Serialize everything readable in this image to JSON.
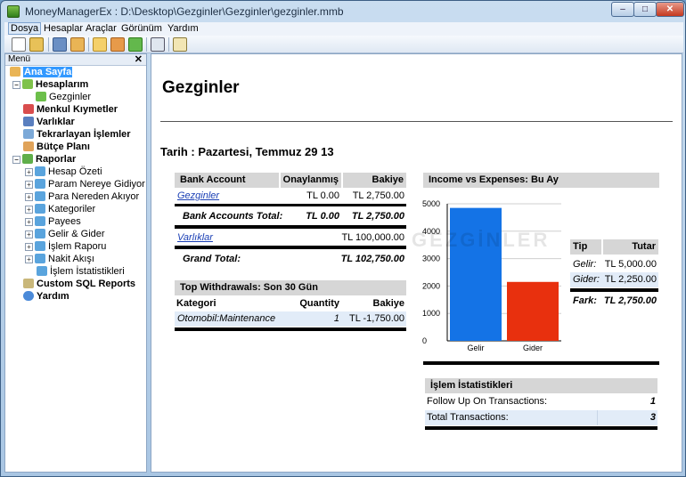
{
  "window": {
    "title": "MoneyManagerEx : D:\\Desktop\\Gezginler\\Gezginler\\gezginler.mmb",
    "min": "–",
    "max": "□",
    "close": "✕"
  },
  "menubar": {
    "items": [
      "Dosya",
      "Hesaplar",
      "Araçlar",
      "Görünüm",
      "Yardım"
    ]
  },
  "sidebar": {
    "header": "Menü",
    "close": "✕",
    "items": [
      {
        "label": "Ana Sayfa",
        "icon": "home-icon"
      },
      {
        "label": "Hesaplarım",
        "icon": "accounts-icon"
      },
      {
        "label": "Gezginler",
        "icon": "account-icon"
      },
      {
        "label": "Menkul Kıymetler",
        "icon": "stocks-icon"
      },
      {
        "label": "Varlıklar",
        "icon": "car-icon"
      },
      {
        "label": "Tekrarlayan İşlemler",
        "icon": "repeat-icon"
      },
      {
        "label": "Bütçe Planı",
        "icon": "budget-icon"
      },
      {
        "label": "Raporlar",
        "icon": "reports-icon"
      },
      {
        "label": "Hesap Özeti",
        "icon": "pie-icon"
      },
      {
        "label": "Param Nereye Gidiyor",
        "icon": "pie-icon"
      },
      {
        "label": "Para Nereden Akıyor",
        "icon": "pie-icon"
      },
      {
        "label": "Kategoriler",
        "icon": "pie-icon"
      },
      {
        "label": "Payees",
        "icon": "pie-icon"
      },
      {
        "label": "Gelir & Gider",
        "icon": "pie-icon"
      },
      {
        "label": "İşlem Raporu",
        "icon": "pie-icon"
      },
      {
        "label": "Nakit Akışı",
        "icon": "pie-icon"
      },
      {
        "label": "İşlem İstatistikleri",
        "icon": "pie-icon"
      },
      {
        "label": "Custom SQL Reports",
        "icon": "sql-icon"
      },
      {
        "label": "Yardım",
        "icon": "help-icon"
      }
    ]
  },
  "main": {
    "title": "Gezginler",
    "date": "Tarih : Pazartesi, Temmuz 29 13",
    "accounts": {
      "headers": [
        "Bank Account",
        "Onaylanmış",
        "Bakiye"
      ],
      "rows": [
        {
          "name": "Gezginler",
          "reconciled": "TL  0.00",
          "balance": "TL  2,750.00"
        }
      ],
      "total_label": "Bank Accounts Total:",
      "total_reconciled": "TL  0.00",
      "total_balance": "TL  2,750.00",
      "asset_row": {
        "name": "Varlıklar",
        "balance": "TL  100,000.00"
      },
      "grand_label": "Grand Total:",
      "grand_total": "TL  102,750.00"
    },
    "withdrawals": {
      "title": "Top Withdrawals: Son 30 Gün",
      "headers": [
        "Kategori",
        "Quantity",
        "Bakiye"
      ],
      "rows": [
        {
          "category": "Otomobil:Maintenance",
          "qty": "1",
          "amount": "TL  -1,750.00"
        }
      ]
    },
    "income_expenses": {
      "title": "Income vs Expenses: Bu Ay",
      "table_headers": [
        "Tip",
        "Tutar"
      ],
      "rows": [
        {
          "type": "Gelir:",
          "amount": "TL  5,000.00"
        },
        {
          "type": "Gider:",
          "amount": "TL  2,250.00"
        }
      ],
      "diff_label": "Fark:",
      "diff_value": "TL  2,750.00"
    },
    "stats": {
      "title": "İşlem İstatistikleri",
      "rows": [
        {
          "label": "Follow Up On Transactions:",
          "value": "1"
        },
        {
          "label": "Total Transactions:",
          "value": "3"
        }
      ]
    },
    "watermark": "GEZGİNLER"
  },
  "chart_data": {
    "type": "bar",
    "categories": [
      "Gelir",
      "Gider"
    ],
    "values": [
      4850,
      2150
    ],
    "colors": [
      "#1473e6",
      "#e8300e"
    ],
    "ylim": [
      0,
      5000
    ],
    "yticks": [
      0,
      1000,
      2000,
      3000,
      4000,
      5000
    ],
    "title": "",
    "xlabel": "",
    "ylabel": "",
    "grid": true
  }
}
